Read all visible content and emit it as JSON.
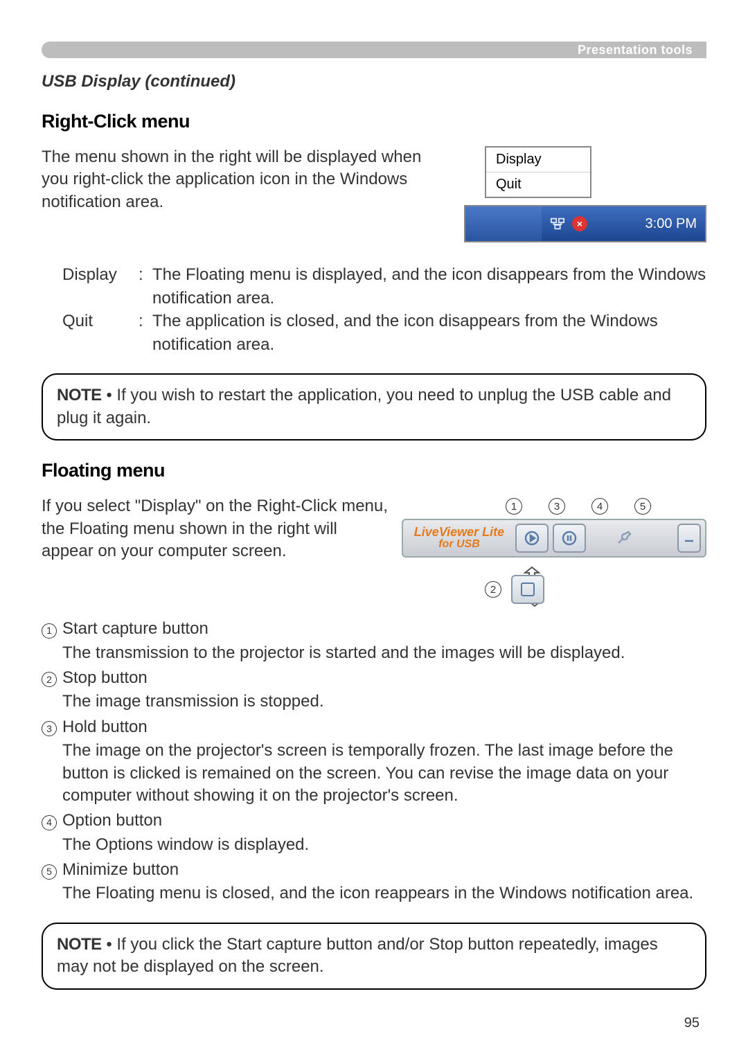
{
  "header": {
    "category": "Presentation tools"
  },
  "subtitle": "USB Display (continued)",
  "section1": {
    "heading": "Right-Click menu",
    "para": "The menu shown in the right will be displayed when you right-click the application icon in the Windows notification area.",
    "menu": {
      "item1": "Display",
      "item2": "Quit"
    },
    "tray_time": "3:00 PM",
    "defs": [
      {
        "term": "Display",
        "desc": "The Floating menu is displayed, and the icon disappears from the Windows notification area."
      },
      {
        "term": "Quit",
        "desc": "The application is closed, and the icon disappears from the Windows notification area."
      }
    ]
  },
  "note1": {
    "label": "NOTE",
    "text": "• If you wish to restart the application, you need to unplug the USB cable and plug it again."
  },
  "section2": {
    "heading": "Floating menu",
    "para": "If you select \"Display\" on the Right-Click menu, the Floating menu shown in the right will appear on your computer screen.",
    "toolbar": {
      "brand_line1": "LiveViewer Lite",
      "brand_line2": "for USB"
    },
    "callouts": {
      "c1": "1",
      "c2": "2",
      "c3": "3",
      "c4": "4",
      "c5": "5"
    },
    "items": [
      {
        "num": "1",
        "title": "Start capture button",
        "desc": "The transmission to the projector is started and the images will be displayed."
      },
      {
        "num": "2",
        "title": "Stop button",
        "desc": "The image transmission is stopped."
      },
      {
        "num": "3",
        "title": "Hold button",
        "desc": "The image on the projector's screen is temporally frozen. The last image before the button is clicked is remained on the screen. You can revise the image data on your computer without showing it on the projector's screen."
      },
      {
        "num": "4",
        "title": "Option button",
        "desc": "The Options window is displayed."
      },
      {
        "num": "5",
        "title": "Minimize button",
        "desc": "The Floating menu is closed, and the icon reappears in the Windows notification area."
      }
    ]
  },
  "note2": {
    "label": "NOTE",
    "text": "• If you click the Start capture button and/or Stop button repeatedly, images may not be displayed on the screen."
  },
  "page_number": "95"
}
